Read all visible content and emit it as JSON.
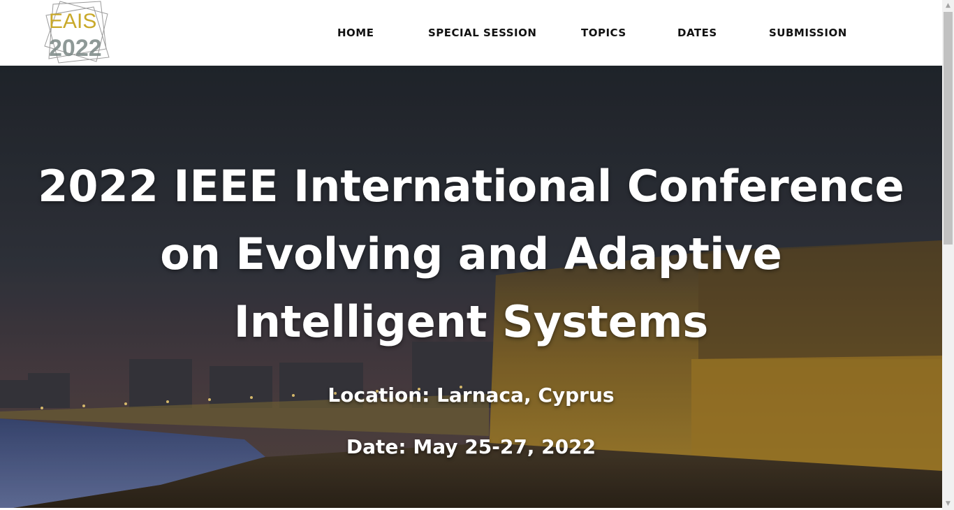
{
  "logo": {
    "text_top": "EAIS",
    "text_bottom": "2022",
    "colors": {
      "top": "#c9a92a",
      "bottom": "#7b8886",
      "frame": "#9a9a9a"
    }
  },
  "nav": {
    "items": [
      {
        "label": "HOME"
      },
      {
        "label": "SPECIAL SESSION"
      },
      {
        "label": "TOPICS"
      },
      {
        "label": "DATES"
      },
      {
        "label": "SUBMISSION"
      }
    ]
  },
  "hero": {
    "title": "2022 IEEE International Conference on Evolving and Adaptive Intelligent Systems",
    "location": "Location: Larnaca, Cyprus",
    "date": "Date: May 25-27, 2022",
    "colors": {
      "sky_top": "#262b33",
      "fort_lit": "#b08a2e",
      "sea": "#4a5a88"
    }
  },
  "scrollbar": {
    "up_icon": "arrow-up-icon",
    "down_icon": "arrow-down-icon"
  }
}
